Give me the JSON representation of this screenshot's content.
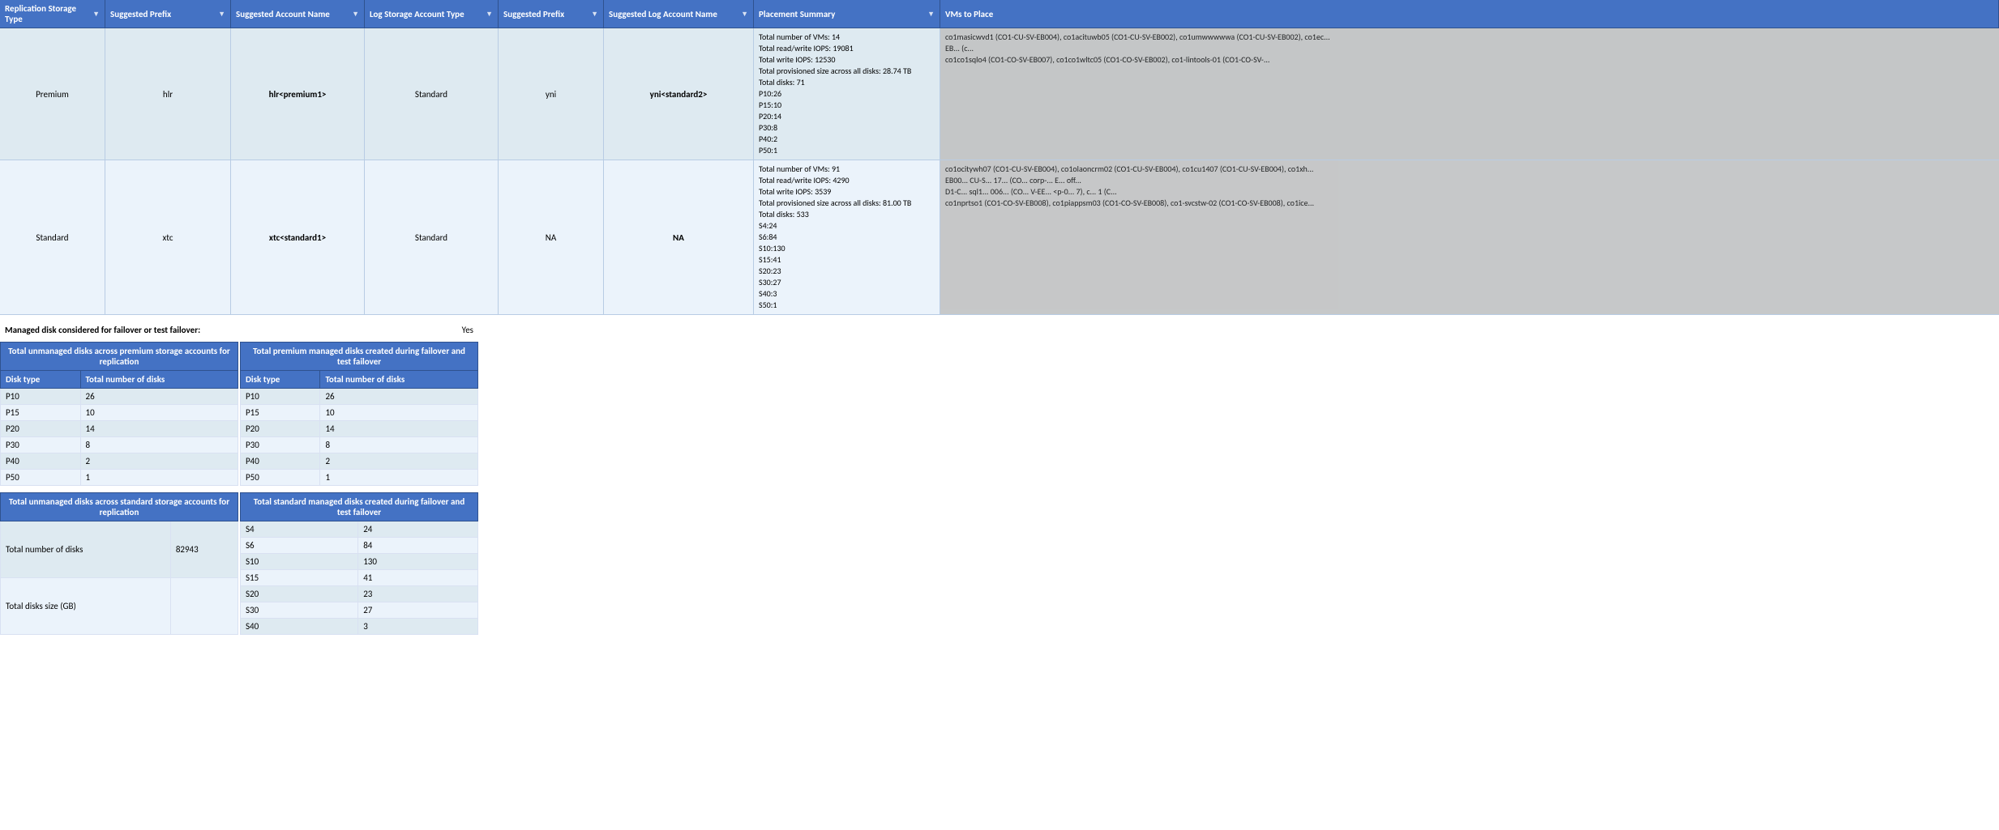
{
  "header": {
    "columns": [
      {
        "label": "Replication Storage Type",
        "key": "col-replication"
      },
      {
        "label": "Suggested Prefix",
        "key": "col-suggested-prefix"
      },
      {
        "label": "Suggested Account Name",
        "key": "col-suggested-account"
      },
      {
        "label": "Log Storage Account Type",
        "key": "col-log-storage"
      },
      {
        "label": "Suggested Prefix",
        "key": "col-log-prefix"
      },
      {
        "label": "Suggested Log Account Name",
        "key": "col-log-account"
      },
      {
        "label": "Placement Summary",
        "key": "col-placement"
      },
      {
        "label": "VMs to Place",
        "key": "col-vms"
      }
    ]
  },
  "rows": [
    {
      "type": "premium",
      "replication": "Premium",
      "prefix": "hlr",
      "account": "hlr<premium1>",
      "logType": "Standard",
      "logPrefix": "yni",
      "logAccount": "yni<standard2>",
      "placement": {
        "totalVMs": "Total number of VMs: 14",
        "totalRW": "Total read/write IOPS: 19081",
        "totalW": "Total write IOPS: 12530",
        "totalSize": "Total provisioned size across all disks: 28.74 TB",
        "totalDisks": "Total disks: 71",
        "diskBreakdown": [
          "P10:26",
          "P15:10",
          "P20:14",
          "P30:8",
          "P40:2",
          "P50:1"
        ]
      },
      "vms": "co1masicwvd1 (CO1-CU-SV-EB004), co1acituwb05 (CO1-CU-SV-EB002), co1umwwwwwa (CO1-CU-SV-EB002), co1ec... EB... (c... co1co1sqlo4 (CO1-CO-SV-EB007), co1co1wltc05 (CO1-CO-SV-EB002), co1-lintools-01 (CO1-CO-SV-..."
    },
    {
      "type": "standard",
      "replication": "Standard",
      "prefix": "xtc",
      "account": "xtc<standard1>",
      "logType": "Standard",
      "logPrefix": "NA",
      "logAccount": "NA",
      "placement": {
        "totalVMs": "Total number of VMs: 91",
        "totalRW": "Total read/write IOPS: 4290",
        "totalW": "Total write IOPS: 3539",
        "totalSize": "Total provisioned size across all disks: 81.00 TB",
        "totalDisks": "Total disks: 533",
        "diskBreakdown": [
          "S4:24",
          "S6:84",
          "S10:130",
          "S15:41",
          "S20:23",
          "S30:27",
          "S40:3",
          "S50:1"
        ]
      },
      "vms": "co1ocitywh07 (CO1-CU-SV-EB004), co1olaoncrm02 (CO1-CU-SV-EB004), co1cu1407 (CO1-CU-SV-EB004), co1xh... EB00... CU-S... 17... (CO... corp-... E... off... co1i... co1... (CO... co1i... co1nprtso1 (CO1-CO-SV-EB008), co1piappsm03 (CO1-CO-SV-EB008), co1-svcstw-02 (CO1-CO-SV-EB008), co1ice..."
    }
  ],
  "managedDisk": {
    "label": "Managed disk considered for failover or test failover:",
    "value": "Yes"
  },
  "premiumUnmanaged": {
    "title": "Total  unmanaged disks across premium storage accounts for replication",
    "headers": [
      "Disk type",
      "Total number of disks"
    ],
    "rows": [
      [
        "P10",
        "26"
      ],
      [
        "P15",
        "10"
      ],
      [
        "P20",
        "14"
      ],
      [
        "P30",
        "8"
      ],
      [
        "P40",
        "2"
      ],
      [
        "P50",
        "1"
      ]
    ]
  },
  "premiumManaged": {
    "title": "Total premium managed disks created during failover and test failover",
    "headers": [
      "Disk type",
      "Total number of disks"
    ],
    "rows": [
      [
        "P10",
        "26"
      ],
      [
        "P15",
        "10"
      ],
      [
        "P20",
        "14"
      ],
      [
        "P30",
        "8"
      ],
      [
        "P40",
        "2"
      ],
      [
        "P50",
        "1"
      ]
    ]
  },
  "standardUnmanaged": {
    "title": "Total unmanaged disks across standard storage accounts for replication",
    "headers": [
      "Total number of disks",
      "82943"
    ],
    "rows": [
      [
        "Total disks size (GB)",
        ""
      ]
    ]
  },
  "standardManaged": {
    "title": "Total standard managed disks created during failover and test failover",
    "rows": [
      [
        "S4",
        "24"
      ],
      [
        "S6",
        "84"
      ],
      [
        "S10",
        "130"
      ],
      [
        "S15",
        "41"
      ],
      [
        "S20",
        "23"
      ],
      [
        "S30",
        "27"
      ],
      [
        "S40",
        "3"
      ]
    ]
  }
}
